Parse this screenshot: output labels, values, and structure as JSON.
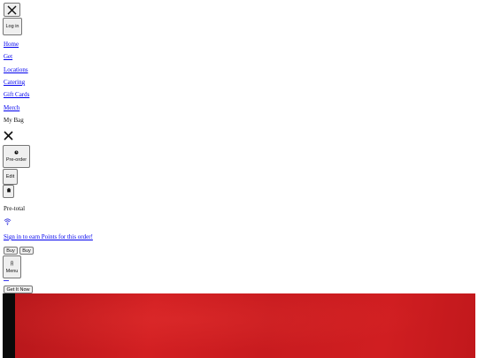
{
  "header": {
    "close_icon": "close-icon",
    "login_label": "Log in"
  },
  "nav": {
    "items": [
      {
        "label": "Home"
      },
      {
        "label": "Get"
      },
      {
        "label": "Locations"
      },
      {
        "label": "Catering"
      },
      {
        "label": "Gift Cards"
      },
      {
        "label": "Merch"
      }
    ]
  },
  "bag": {
    "title": "My Bag",
    "close_icon": "close-icon",
    "preorder_label": "Pre-order",
    "edit_label": "Edit",
    "pretotal_label": "Pre-total",
    "signin_link": "Sign in to earn Points for this order!",
    "buy_label_1": "Buy",
    "buy_label_2": "Buy",
    "menu_label": "Menu"
  },
  "hero": {
    "cta_label": "Get It Now",
    "colors": {
      "red": "#c7191d",
      "dark": "#0a0a0a"
    }
  }
}
